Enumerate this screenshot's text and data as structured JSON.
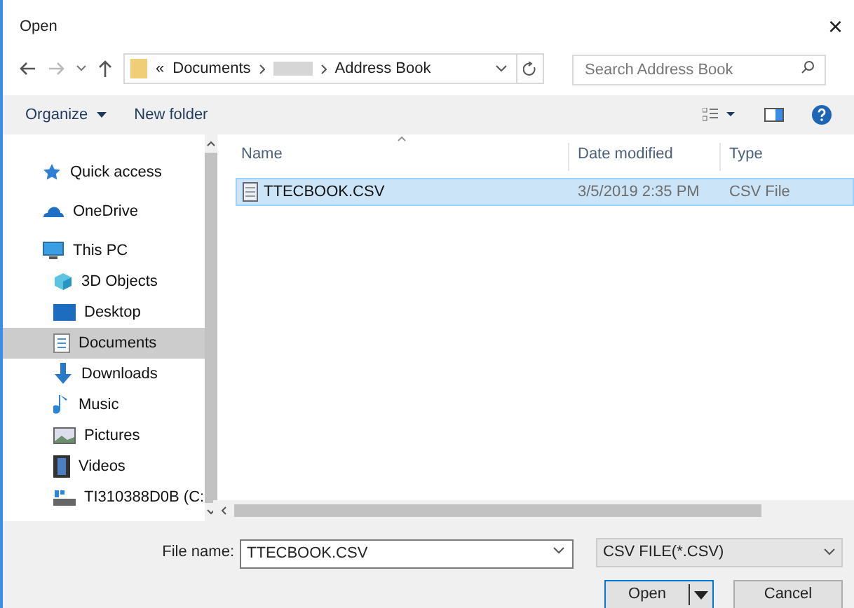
{
  "window": {
    "title": "Open",
    "close": "×"
  },
  "address": {
    "prefix": "«",
    "segments": [
      "Documents",
      "Address Book"
    ],
    "search_placeholder": "Search Address Book"
  },
  "toolbar": {
    "organize": "Organize",
    "new_folder": "New folder"
  },
  "sidebar": {
    "items": [
      {
        "label": "Quick access",
        "selected": false
      },
      {
        "label": "OneDrive",
        "selected": false
      },
      {
        "label": "This PC",
        "selected": false,
        "children": [
          {
            "label": "3D Objects",
            "selected": false
          },
          {
            "label": "Desktop",
            "selected": false
          },
          {
            "label": "Documents",
            "selected": true
          },
          {
            "label": "Downloads",
            "selected": false
          },
          {
            "label": "Music",
            "selected": false
          },
          {
            "label": "Pictures",
            "selected": false
          },
          {
            "label": "Videos",
            "selected": false
          },
          {
            "label": "TI310388D0B (C:",
            "selected": false
          }
        ]
      }
    ]
  },
  "table": {
    "columns": [
      "Name",
      "Date modified",
      "Type"
    ],
    "rows": [
      {
        "cells": [
          "TTECBOOK.CSV",
          "3/5/2019 2:35 PM",
          "CSV File"
        ],
        "selected": true
      }
    ]
  },
  "footer": {
    "file_name_label": "File name:",
    "file_name": "TTECBOOK.CSV",
    "filter": "CSV FILE(*.CSV)",
    "open": "Open",
    "cancel": "Cancel"
  }
}
